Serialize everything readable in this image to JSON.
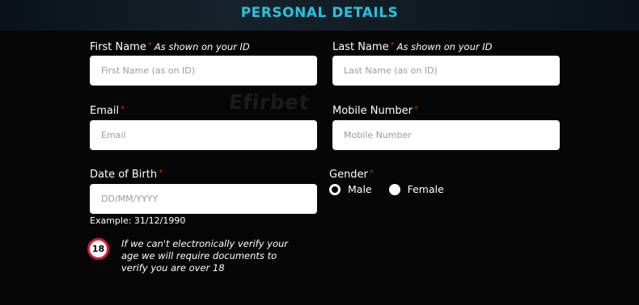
{
  "header": {
    "title": "PERSONAL DETAILS"
  },
  "watermark": "Efirbet",
  "form": {
    "required_mark": "*",
    "first_name": {
      "label": "First Name",
      "hint": "As shown on your ID",
      "placeholder": "First Name (as on ID)",
      "value": ""
    },
    "last_name": {
      "label": "Last Name",
      "hint": "As shown on your ID",
      "placeholder": "Last Name (as on ID)",
      "value": ""
    },
    "email": {
      "label": "Email",
      "placeholder": "Email",
      "value": ""
    },
    "mobile": {
      "label": "Mobile Number",
      "placeholder": "Mobile Number",
      "value": ""
    },
    "dob": {
      "label": "Date of Birth",
      "placeholder": "DD/MM/YYYY",
      "example": "Example: 31/12/1990",
      "value": ""
    },
    "gender": {
      "label": "Gender",
      "options": [
        {
          "label": "Male",
          "checked": true
        },
        {
          "label": "Female",
          "checked": false
        }
      ]
    },
    "age_notice": {
      "badge": "18",
      "text": "If we can't electronically verify your age we will require documents to verify you are over 18"
    }
  },
  "colors": {
    "accent": "#27c3dc",
    "required": "#e02020",
    "background": "#060606",
    "badge_border": "#d8202a"
  }
}
